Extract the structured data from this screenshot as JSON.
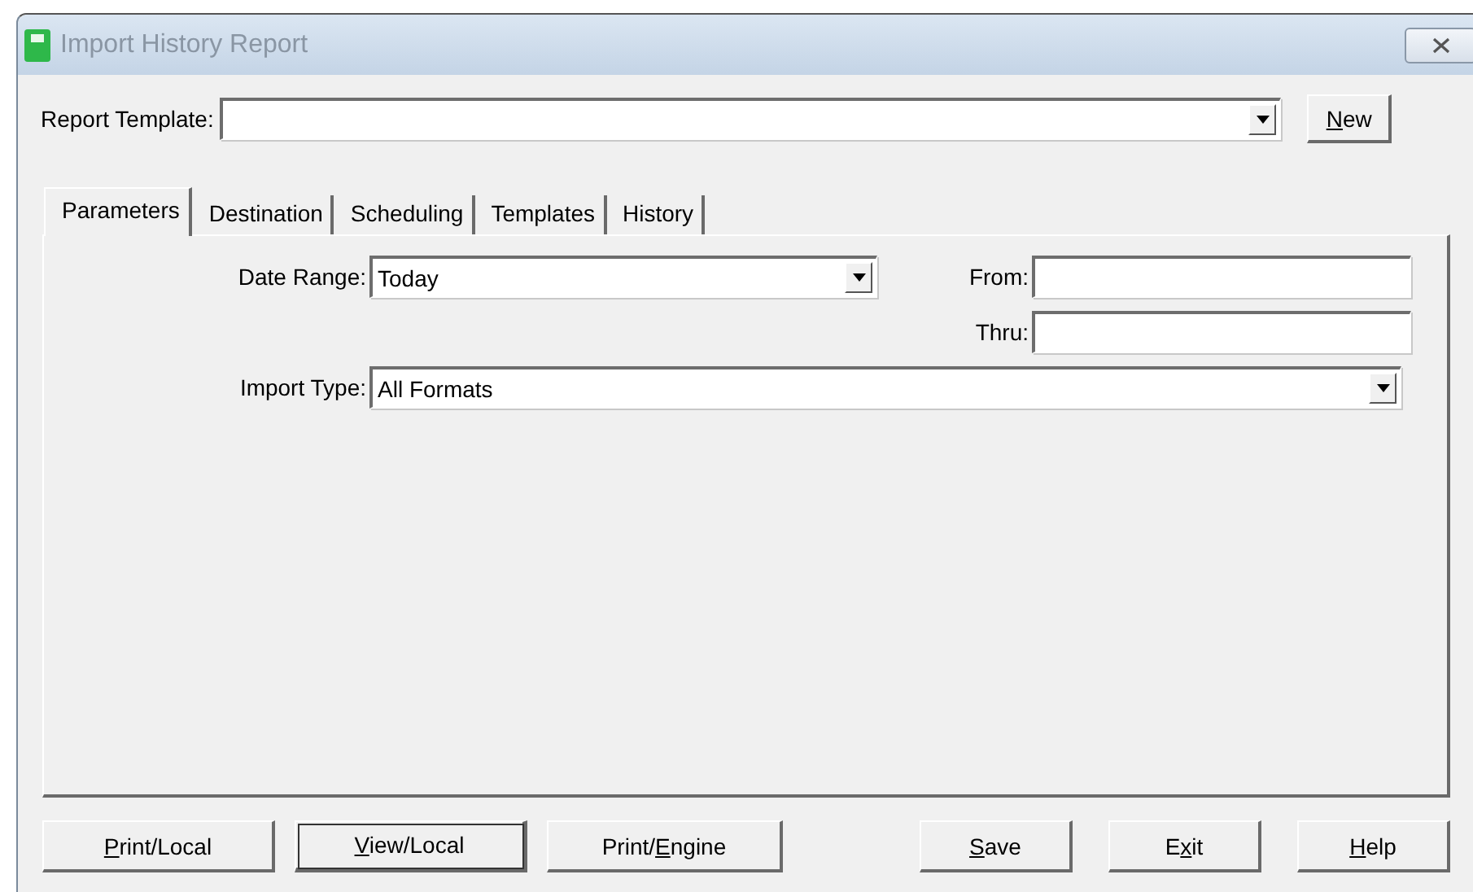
{
  "window": {
    "title": "Import History Report"
  },
  "report_template": {
    "label": "Report Template:",
    "new_button": {
      "label_parts": [
        {
          "text": "N",
          "underlined": true
        },
        {
          "text": "ew",
          "underlined": false
        }
      ]
    }
  },
  "tabs": [
    {
      "label": "Parameters",
      "selected": true
    },
    {
      "label": "Destination",
      "selected": false
    },
    {
      "label": "Scheduling",
      "selected": false
    },
    {
      "label": "Templates",
      "selected": false
    },
    {
      "label": "History",
      "selected": false
    }
  ],
  "parameters": {
    "date_range": {
      "label": "Date Range:",
      "value": "Today"
    },
    "from": {
      "label": "From:"
    },
    "thru": {
      "label": "Thru:"
    },
    "import_type": {
      "label": "Import Type:",
      "value": "All Formats"
    }
  },
  "buttons_left": [
    {
      "label_parts": [
        {
          "text": "P",
          "underlined": true
        },
        {
          "text": "rint/Local",
          "underlined": false
        }
      ],
      "default": false
    },
    {
      "label_parts": [
        {
          "text": "V",
          "underlined": true
        },
        {
          "text": "iew/Local",
          "underlined": false
        }
      ],
      "default": true
    },
    {
      "label_parts": [
        {
          "text": "Print/",
          "underlined": false
        },
        {
          "text": "E",
          "underlined": true
        },
        {
          "text": "ngine",
          "underlined": false
        }
      ],
      "default": false
    }
  ],
  "buttons_right": [
    {
      "label_parts": [
        {
          "text": "S",
          "underlined": true
        },
        {
          "text": "ave",
          "underlined": false
        }
      ],
      "default": false
    },
    {
      "label_parts": [
        {
          "text": "E",
          "underlined": false
        },
        {
          "text": "x",
          "underlined": true
        },
        {
          "text": "it",
          "underlined": false
        }
      ],
      "default": false
    },
    {
      "label_parts": [
        {
          "text": "H",
          "underlined": true
        },
        {
          "text": "elp",
          "underlined": false
        }
      ],
      "default": false
    }
  ]
}
